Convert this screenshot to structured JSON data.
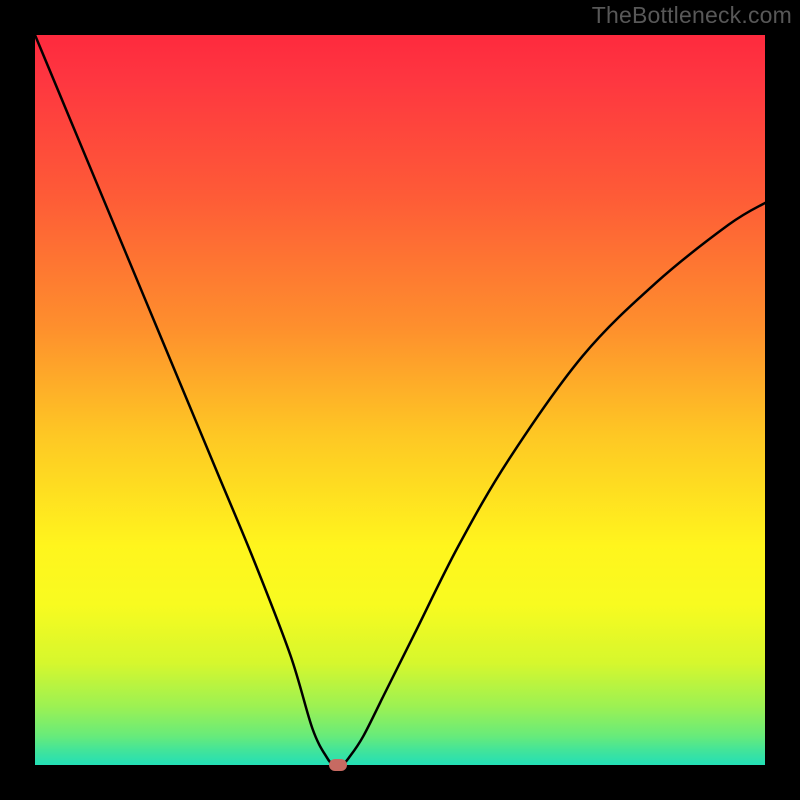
{
  "watermark": "TheBottleneck.com",
  "chart_data": {
    "type": "line",
    "title": "",
    "xlabel": "",
    "ylabel": "",
    "axes_visible": false,
    "grid": false,
    "xlim": [
      0,
      100
    ],
    "ylim": [
      0,
      100
    ],
    "background_gradient": {
      "direction": "vertical",
      "stops": [
        {
          "pos": 0,
          "color": "#fe2a3e"
        },
        {
          "pos": 70,
          "color": "#fff51d"
        },
        {
          "pos": 100,
          "color": "#23dfb6"
        }
      ]
    },
    "series": [
      {
        "name": "bottleneck-curve",
        "type": "line",
        "color": "#000000",
        "x": [
          0,
          5,
          10,
          15,
          20,
          25,
          30,
          35,
          38,
          40,
          41,
          42,
          43,
          45,
          48,
          52,
          58,
          65,
          75,
          85,
          95,
          100
        ],
        "y": [
          100,
          88,
          76,
          64,
          52,
          40,
          28,
          15,
          5,
          1,
          0,
          0,
          1,
          4,
          10,
          18,
          30,
          42,
          56,
          66,
          74,
          77
        ]
      }
    ],
    "annotations": [
      {
        "name": "vertex-marker",
        "shape": "rounded-rect",
        "x": 41.5,
        "y": 0,
        "color": "#c76a62"
      }
    ]
  }
}
